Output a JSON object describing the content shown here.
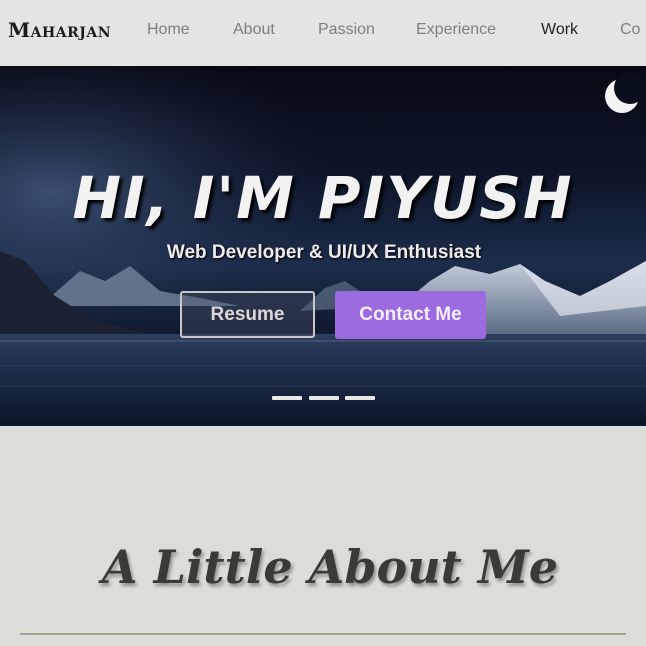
{
  "brand": "Maharjan",
  "nav": {
    "items": [
      {
        "label": "Home",
        "active": false
      },
      {
        "label": "About",
        "active": false
      },
      {
        "label": "Passion",
        "active": false
      },
      {
        "label": "Experience",
        "active": false
      },
      {
        "label": "Work",
        "active": true
      },
      {
        "label": "Co",
        "active": false
      }
    ]
  },
  "hero": {
    "title": "HI, I'M PIYUSH",
    "subtitle": "Web Developer & UI/UX Enthusiast",
    "resume_label": "Resume",
    "contact_label": "Contact Me",
    "slide_count": 3
  },
  "about": {
    "heading": "A Little About Me"
  },
  "colors": {
    "accent": "#9d6be0",
    "nav_bg": "#e4e4e2",
    "page_bg": "#dcdcd8"
  }
}
